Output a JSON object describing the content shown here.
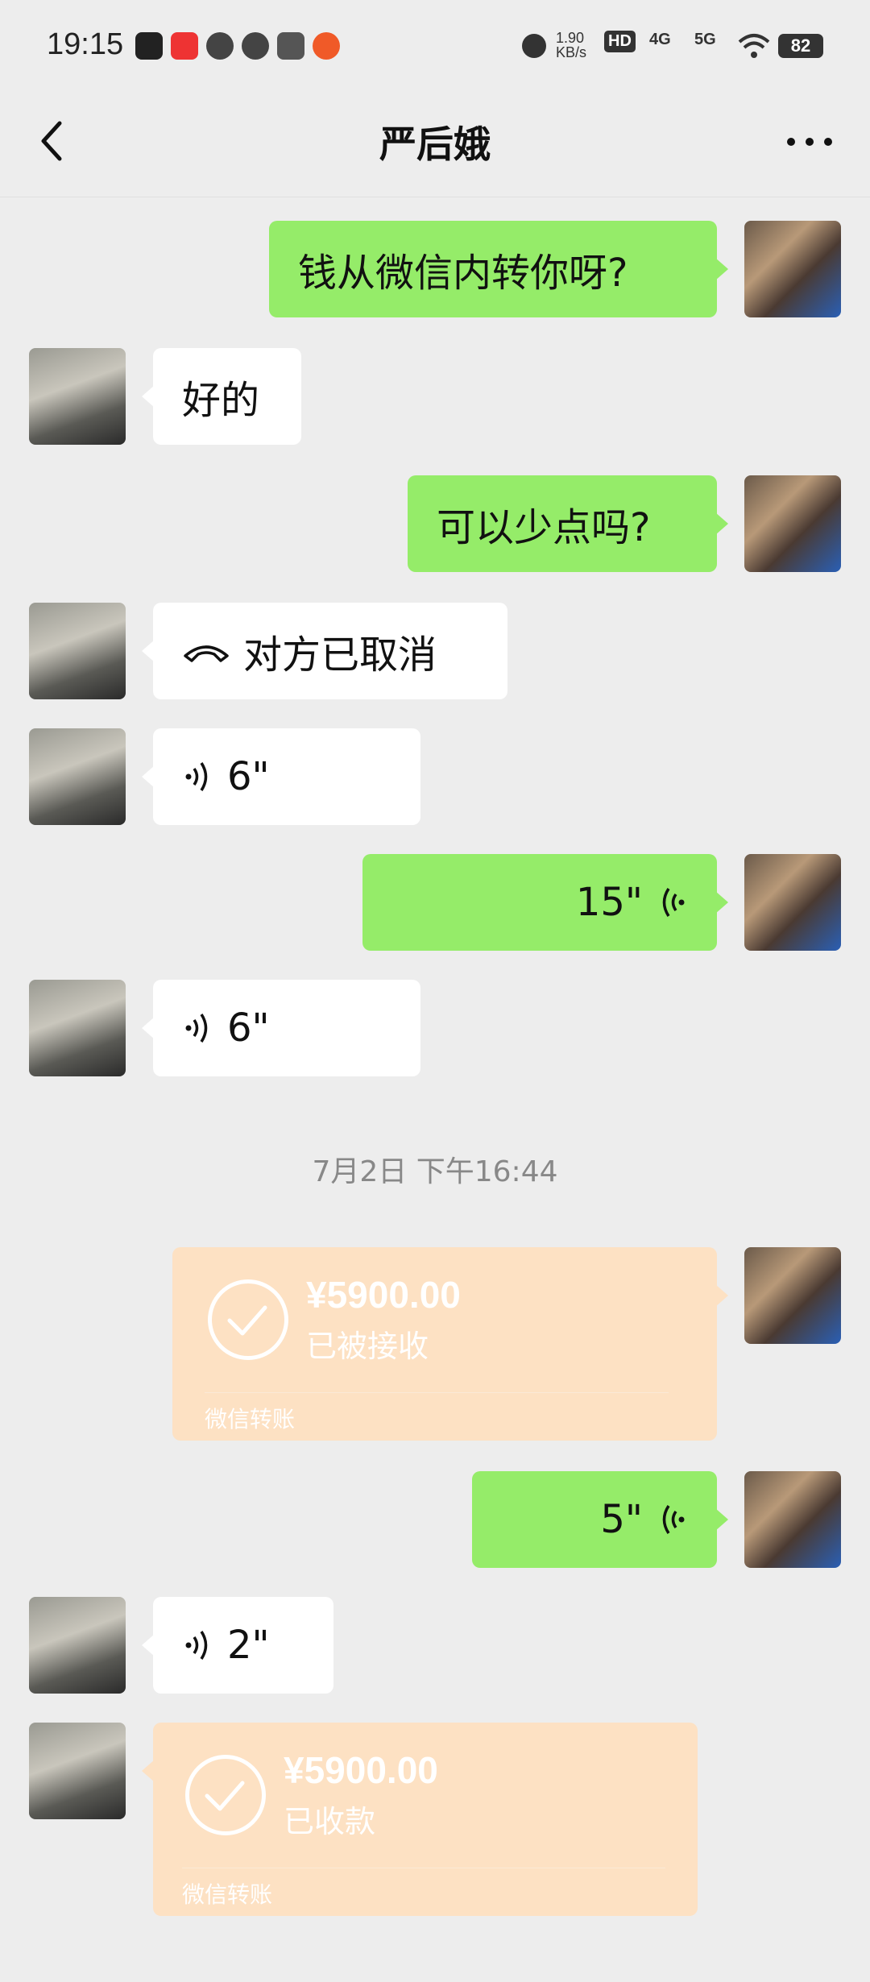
{
  "status_bar": {
    "time": "19:15",
    "net_speed": "1.90 KB/s",
    "hd": "HD",
    "net1": "4G",
    "net2": "5G",
    "battery": "82"
  },
  "header": {
    "title": "严后娥"
  },
  "messages": [
    {
      "side": "self",
      "type": "text",
      "text": "钱从微信内转你呀?"
    },
    {
      "side": "peer",
      "type": "text",
      "text": "好的"
    },
    {
      "side": "self",
      "type": "text",
      "text": "可以少点吗?"
    },
    {
      "side": "peer",
      "type": "call",
      "text": "对方已取消"
    },
    {
      "side": "peer",
      "type": "voice",
      "text": "6\""
    },
    {
      "side": "self",
      "type": "voice",
      "text": "15\""
    },
    {
      "side": "peer",
      "type": "voice",
      "text": "6\""
    },
    {
      "side": "self",
      "type": "transfer",
      "amount": "¥5900.00",
      "status": "已被接收",
      "footer": "微信转账"
    },
    {
      "side": "self",
      "type": "voice",
      "text": "5\""
    },
    {
      "side": "peer",
      "type": "voice",
      "text": "2\""
    },
    {
      "side": "peer",
      "type": "transfer",
      "amount": "¥5900.00",
      "status": "已收款",
      "footer": "微信转账"
    }
  ],
  "timestamp": "7月2日 下午16:44",
  "colors": {
    "self_bubble": "#95ec69",
    "peer_bubble": "#ffffff",
    "transfer": "#fde1c3",
    "background": "#ededed"
  }
}
